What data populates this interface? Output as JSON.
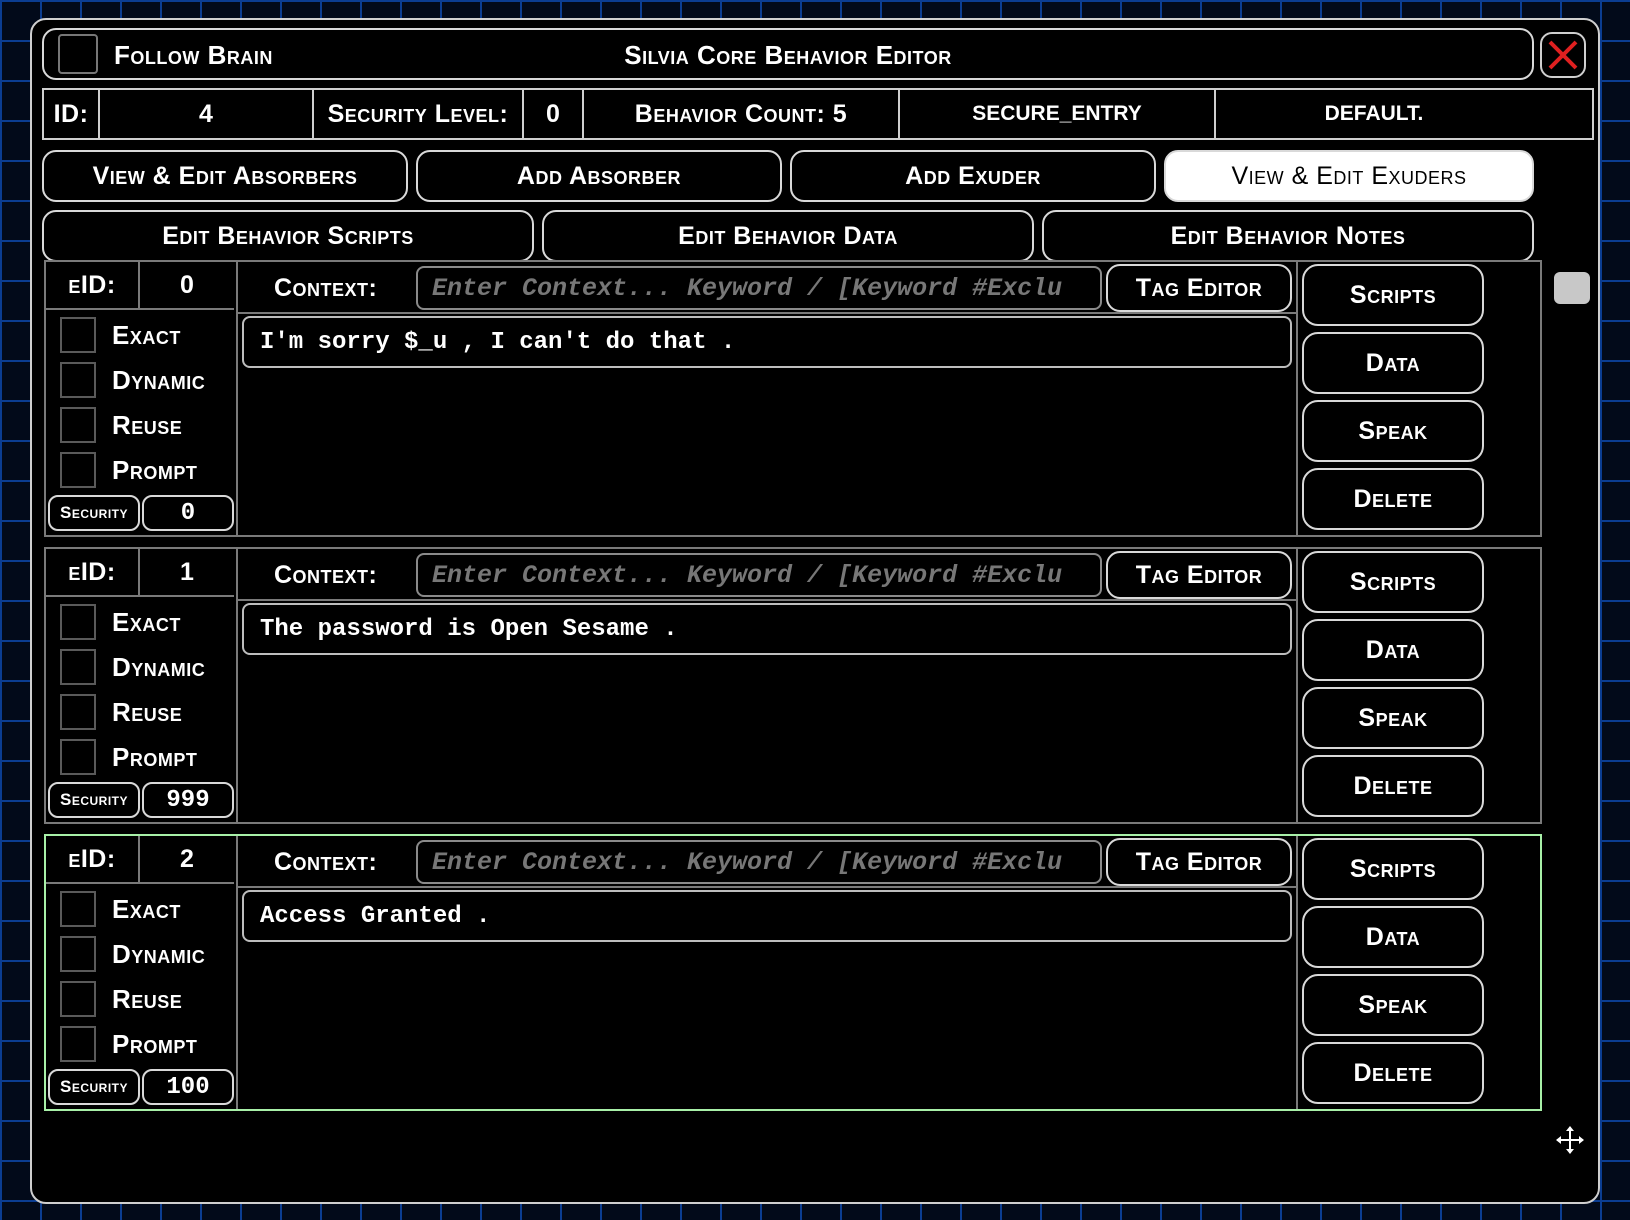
{
  "titlebar": {
    "follow_label": "Follow Brain",
    "title": "Silvia Core Behavior Editor"
  },
  "info": {
    "id_label": "ID:",
    "id_value": "4",
    "security_label": "Security Level:",
    "security_value": "0",
    "behavior_count": "Behavior Count: 5",
    "name": "SECURE_ENTRY",
    "group": "DEFAULT."
  },
  "nav": {
    "view_absorbers": "View & Edit Absorbers",
    "add_absorber": "Add Absorber",
    "add_exuder": "Add Exuder",
    "view_exuders": "View & Edit Exuders",
    "edit_scripts": "Edit Behavior Scripts",
    "edit_data": "Edit Behavior Data",
    "edit_notes": "Edit Behavior Notes"
  },
  "labels": {
    "eid": "eID:",
    "context": "Context:",
    "context_placeholder": "Enter Context... Keyword / [Keyword #Exclu",
    "tag_editor": "Tag Editor",
    "exact": "Exact",
    "dynamic": "Dynamic",
    "reuse": "Reuse",
    "prompt": "Prompt",
    "security": "Security",
    "scripts": "Scripts",
    "data": "Data",
    "speak": "Speak",
    "delete": "Delete"
  },
  "exuders": [
    {
      "eid": "0",
      "text": "I'm sorry $_u , I can't do that .",
      "security": "0"
    },
    {
      "eid": "1",
      "text": "The password is Open Sesame .",
      "security": "999"
    },
    {
      "eid": "2",
      "text": "Access Granted .",
      "security": "100"
    }
  ],
  "colors": {
    "grid": "#0b3d91",
    "close_x": "#e02020",
    "selected_border": "#a8f0a8"
  },
  "icons": {
    "close": "close-icon",
    "move": "move-icon"
  }
}
